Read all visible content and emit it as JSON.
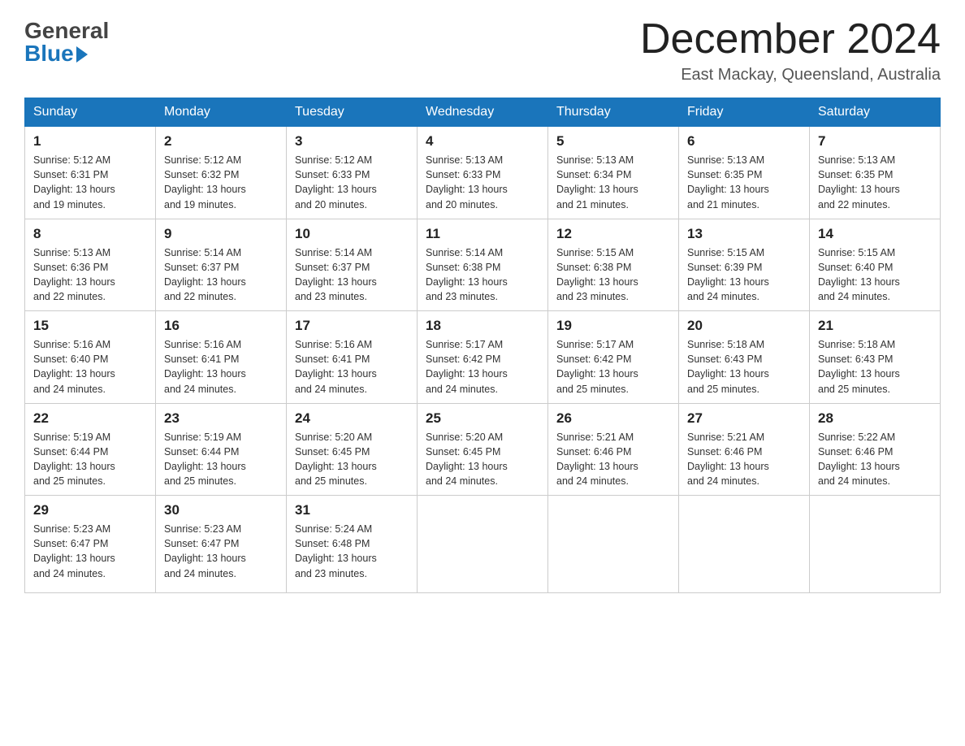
{
  "header": {
    "logo_line1": "General",
    "logo_line2": "Blue",
    "month_title": "December 2024",
    "location": "East Mackay, Queensland, Australia"
  },
  "weekdays": [
    "Sunday",
    "Monday",
    "Tuesday",
    "Wednesday",
    "Thursday",
    "Friday",
    "Saturday"
  ],
  "weeks": [
    [
      {
        "day": "1",
        "sunrise": "5:12 AM",
        "sunset": "6:31 PM",
        "daylight": "13 hours and 19 minutes."
      },
      {
        "day": "2",
        "sunrise": "5:12 AM",
        "sunset": "6:32 PM",
        "daylight": "13 hours and 19 minutes."
      },
      {
        "day": "3",
        "sunrise": "5:12 AM",
        "sunset": "6:33 PM",
        "daylight": "13 hours and 20 minutes."
      },
      {
        "day": "4",
        "sunrise": "5:13 AM",
        "sunset": "6:33 PM",
        "daylight": "13 hours and 20 minutes."
      },
      {
        "day": "5",
        "sunrise": "5:13 AM",
        "sunset": "6:34 PM",
        "daylight": "13 hours and 21 minutes."
      },
      {
        "day": "6",
        "sunrise": "5:13 AM",
        "sunset": "6:35 PM",
        "daylight": "13 hours and 21 minutes."
      },
      {
        "day": "7",
        "sunrise": "5:13 AM",
        "sunset": "6:35 PM",
        "daylight": "13 hours and 22 minutes."
      }
    ],
    [
      {
        "day": "8",
        "sunrise": "5:13 AM",
        "sunset": "6:36 PM",
        "daylight": "13 hours and 22 minutes."
      },
      {
        "day": "9",
        "sunrise": "5:14 AM",
        "sunset": "6:37 PM",
        "daylight": "13 hours and 22 minutes."
      },
      {
        "day": "10",
        "sunrise": "5:14 AM",
        "sunset": "6:37 PM",
        "daylight": "13 hours and 23 minutes."
      },
      {
        "day": "11",
        "sunrise": "5:14 AM",
        "sunset": "6:38 PM",
        "daylight": "13 hours and 23 minutes."
      },
      {
        "day": "12",
        "sunrise": "5:15 AM",
        "sunset": "6:38 PM",
        "daylight": "13 hours and 23 minutes."
      },
      {
        "day": "13",
        "sunrise": "5:15 AM",
        "sunset": "6:39 PM",
        "daylight": "13 hours and 24 minutes."
      },
      {
        "day": "14",
        "sunrise": "5:15 AM",
        "sunset": "6:40 PM",
        "daylight": "13 hours and 24 minutes."
      }
    ],
    [
      {
        "day": "15",
        "sunrise": "5:16 AM",
        "sunset": "6:40 PM",
        "daylight": "13 hours and 24 minutes."
      },
      {
        "day": "16",
        "sunrise": "5:16 AM",
        "sunset": "6:41 PM",
        "daylight": "13 hours and 24 minutes."
      },
      {
        "day": "17",
        "sunrise": "5:16 AM",
        "sunset": "6:41 PM",
        "daylight": "13 hours and 24 minutes."
      },
      {
        "day": "18",
        "sunrise": "5:17 AM",
        "sunset": "6:42 PM",
        "daylight": "13 hours and 24 minutes."
      },
      {
        "day": "19",
        "sunrise": "5:17 AM",
        "sunset": "6:42 PM",
        "daylight": "13 hours and 25 minutes."
      },
      {
        "day": "20",
        "sunrise": "5:18 AM",
        "sunset": "6:43 PM",
        "daylight": "13 hours and 25 minutes."
      },
      {
        "day": "21",
        "sunrise": "5:18 AM",
        "sunset": "6:43 PM",
        "daylight": "13 hours and 25 minutes."
      }
    ],
    [
      {
        "day": "22",
        "sunrise": "5:19 AM",
        "sunset": "6:44 PM",
        "daylight": "13 hours and 25 minutes."
      },
      {
        "day": "23",
        "sunrise": "5:19 AM",
        "sunset": "6:44 PM",
        "daylight": "13 hours and 25 minutes."
      },
      {
        "day": "24",
        "sunrise": "5:20 AM",
        "sunset": "6:45 PM",
        "daylight": "13 hours and 25 minutes."
      },
      {
        "day": "25",
        "sunrise": "5:20 AM",
        "sunset": "6:45 PM",
        "daylight": "13 hours and 24 minutes."
      },
      {
        "day": "26",
        "sunrise": "5:21 AM",
        "sunset": "6:46 PM",
        "daylight": "13 hours and 24 minutes."
      },
      {
        "day": "27",
        "sunrise": "5:21 AM",
        "sunset": "6:46 PM",
        "daylight": "13 hours and 24 minutes."
      },
      {
        "day": "28",
        "sunrise": "5:22 AM",
        "sunset": "6:46 PM",
        "daylight": "13 hours and 24 minutes."
      }
    ],
    [
      {
        "day": "29",
        "sunrise": "5:23 AM",
        "sunset": "6:47 PM",
        "daylight": "13 hours and 24 minutes."
      },
      {
        "day": "30",
        "sunrise": "5:23 AM",
        "sunset": "6:47 PM",
        "daylight": "13 hours and 24 minutes."
      },
      {
        "day": "31",
        "sunrise": "5:24 AM",
        "sunset": "6:48 PM",
        "daylight": "13 hours and 23 minutes."
      },
      null,
      null,
      null,
      null
    ]
  ],
  "labels": {
    "sunrise": "Sunrise:",
    "sunset": "Sunset:",
    "daylight": "Daylight:"
  }
}
